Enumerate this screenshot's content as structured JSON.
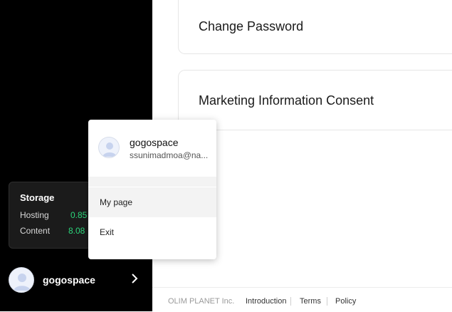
{
  "sidebar": {
    "storage": {
      "title": "Storage",
      "hosting_label": "Hosting",
      "hosting_value": "0.85",
      "content_label": "Content",
      "content_value": "8.08"
    },
    "user": {
      "name": "gogospace",
      "avatar_icon": "user-avatar-icon",
      "chevron_icon": "chevron-right-icon"
    }
  },
  "main": {
    "cards": [
      {
        "title": "Change Password"
      },
      {
        "title": "Marketing Information Consent"
      }
    ]
  },
  "popup": {
    "name": "gogospace",
    "email": "ssunimadmoa@na...",
    "items": [
      {
        "label": "My page"
      },
      {
        "label": "Exit"
      }
    ]
  },
  "footer": {
    "company": "OLIM PLANET Inc.",
    "links": [
      "Introduction",
      "Terms",
      "Policy"
    ]
  },
  "colors": {
    "sidebar_bg": "#000000",
    "storage_value": "#2bd67b"
  }
}
